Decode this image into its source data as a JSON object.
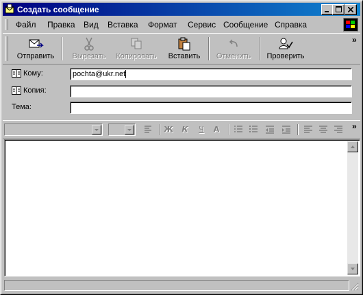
{
  "window": {
    "title": "Создать сообщение",
    "title_icon": "new-message-envelope-icon"
  },
  "menu": [
    {
      "label": "Файл"
    },
    {
      "label": "Правка"
    },
    {
      "label": "Вид"
    },
    {
      "label": "Вставка"
    },
    {
      "label": "Формат"
    },
    {
      "label": "Сервис"
    },
    {
      "label": "Сообщение"
    },
    {
      "label": "Справка"
    }
  ],
  "toolbar": {
    "send": {
      "label": "Отправить",
      "icon": "send-icon",
      "enabled": true
    },
    "cut": {
      "label": "Вырезать",
      "icon": "scissors-icon",
      "enabled": false
    },
    "copy": {
      "label": "Копировать",
      "icon": "copy-icon",
      "enabled": false
    },
    "paste": {
      "label": "Вставить",
      "icon": "paste-icon",
      "enabled": true
    },
    "undo": {
      "label": "Отменить",
      "icon": "undo-icon",
      "enabled": false
    },
    "check": {
      "label": "Проверить",
      "icon": "check-names-icon",
      "enabled": true
    }
  },
  "headers": {
    "to_label": "Кому:",
    "to_value": "pochta@ukr.net",
    "cc_label": "Копия:",
    "cc_value": "",
    "subject_label": "Тема:",
    "subject_value": ""
  },
  "format_toolbar": {
    "bold_glyph": "Ж",
    "italic_glyph": "К",
    "underline_glyph": "Ч",
    "font_color_glyph": "A"
  },
  "colors": {
    "face": "#c0c0c0",
    "titlebar": "#000080",
    "disabled": "#808080"
  }
}
